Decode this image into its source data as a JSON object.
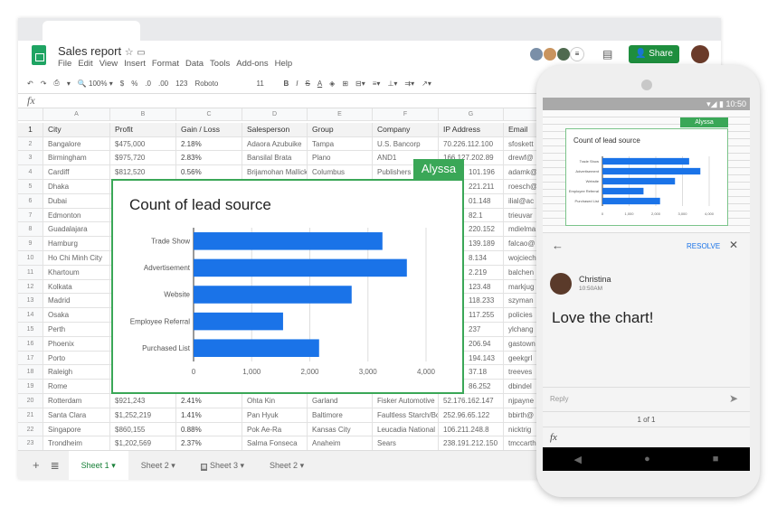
{
  "app": {
    "doc_title": "Sales report",
    "menu": [
      "File",
      "Edit",
      "View",
      "Insert",
      "Format",
      "Data",
      "Tools",
      "Add-ons",
      "Help"
    ],
    "share_label": "Share",
    "accent": "#1e8e3e"
  },
  "toolbar": {
    "zoom": "100%",
    "currency": "$",
    "percent": "%",
    "dec_less": ".0",
    "dec_more": ".00",
    "format": "123",
    "font": "Roboto",
    "size": "11",
    "bold": "B",
    "italic": "I",
    "strike": "S",
    "text_color": "A"
  },
  "formula_bar": {
    "fx": "fx"
  },
  "columns": [
    "A",
    "B",
    "C",
    "D",
    "E",
    "F",
    "G",
    ""
  ],
  "header_row": [
    "City",
    "Profit",
    "Gain / Loss",
    "Salesperson",
    "Group",
    "Company",
    "IP Address",
    "Email"
  ],
  "rows": [
    [
      "Bangalore",
      "$475,000",
      "2.18%",
      "Adaora Azubuike",
      "Tampa",
      "U.S. Bancorp",
      "70.226.112.100",
      "sfoskett"
    ],
    [
      "Birmingham",
      "$975,720",
      "2.83%",
      "Bansilal Brata",
      "Plano",
      "AND1",
      "166.127.202.89",
      "drewf@"
    ],
    [
      "Cardiff",
      "$812,520",
      "0.56%",
      "Brijamohan Mallick",
      "Columbus",
      "Publishers",
      "101.196",
      "adamk@"
    ],
    [
      "Dhaka",
      "",
      "",
      "",
      "",
      "",
      "221.211",
      "roesch@"
    ],
    [
      "Dubai",
      "",
      "",
      "",
      "",
      "",
      "01.148",
      "ilial@ac"
    ],
    [
      "Edmonton",
      "",
      "",
      "",
      "",
      "",
      "82.1",
      "trieuvar"
    ],
    [
      "Guadalajara",
      "",
      "",
      "",
      "",
      "",
      "220.152",
      "mdielma"
    ],
    [
      "Hamburg",
      "",
      "",
      "",
      "",
      "",
      "139.189",
      "falcao@"
    ],
    [
      "Ho Chi Minh City",
      "",
      "",
      "",
      "",
      "",
      "8.134",
      "wojciech"
    ],
    [
      "Khartoum",
      "",
      "",
      "",
      "",
      "",
      "2.219",
      "balchen"
    ],
    [
      "Kolkata",
      "",
      "",
      "",
      "",
      "",
      "123.48",
      "markjug"
    ],
    [
      "Madrid",
      "",
      "",
      "",
      "",
      "",
      "118.233",
      "szyman"
    ],
    [
      "Osaka",
      "",
      "",
      "",
      "",
      "",
      "117.255",
      "policies"
    ],
    [
      "Perth",
      "",
      "",
      "",
      "",
      "",
      "237",
      "ylchang"
    ],
    [
      "Phoenix",
      "",
      "",
      "",
      "",
      "",
      "206.94",
      "gastown"
    ],
    [
      "Porto",
      "",
      "",
      "",
      "",
      "",
      "194.143",
      "geekgrl"
    ],
    [
      "Raleigh",
      "",
      "",
      "",
      "",
      "",
      "37.18",
      "treeves"
    ],
    [
      "Rome",
      "",
      "",
      "",
      "",
      "",
      "86.252",
      "dbindel"
    ],
    [
      "Rotterdam",
      "$921,243",
      "2.41%",
      "Ohta Kin",
      "Garland",
      "Fisker Automotive",
      "52.176.162.147",
      "njpayne"
    ],
    [
      "Santa Clara",
      "$1,252,219",
      "1.41%",
      "Pan Hyuk",
      "Baltimore",
      "Faultless Starch/Bo",
      "252.96.65.122",
      "bbirth@"
    ],
    [
      "Singapore",
      "$860,155",
      "0.88%",
      "Pok Ae-Ra",
      "Kansas City",
      "Leucadia National",
      "106.211.248.8",
      "nicktrig"
    ],
    [
      "Trondheim",
      "$1,202,569",
      "2.37%",
      "Salma Fonseca",
      "Anaheim",
      "Sears",
      "238.191.212.150",
      "tmccarth"
    ]
  ],
  "sheets": [
    "Sheet 1",
    "Sheet 2",
    "Sheet 3",
    "Sheet 2"
  ],
  "collaborator_label": "Alyssa",
  "chart_data": {
    "type": "bar",
    "orientation": "horizontal",
    "title": "Count of lead source",
    "categories": [
      "Trade Show",
      "Advertisement",
      "Website",
      "Employee Referral",
      "Purchased List"
    ],
    "values": [
      3250,
      3670,
      2720,
      1540,
      2160
    ],
    "xlim": [
      0,
      4000
    ],
    "ticks": [
      "0",
      "1,000",
      "2,000",
      "3,000",
      "4,000"
    ],
    "grid": true,
    "color": "#1a73e8"
  },
  "phone": {
    "time": "10:50",
    "resolve": "RESOLVE",
    "author": "Christina",
    "comment_time": "10:50AM",
    "comment": "Love the chart!",
    "reply_placeholder": "Reply",
    "pager": "1 of 1",
    "fx": "fx"
  }
}
